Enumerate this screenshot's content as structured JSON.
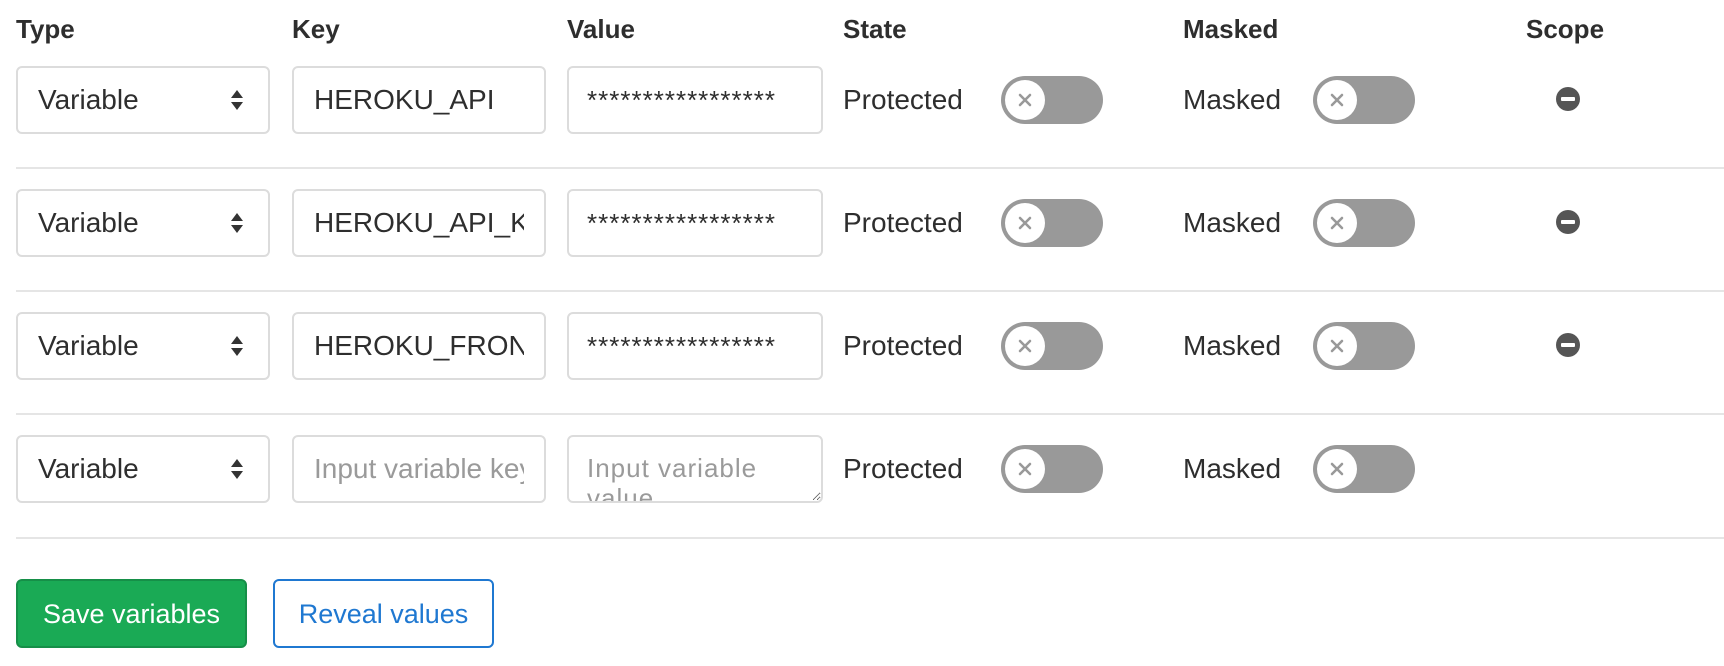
{
  "headers": {
    "type": "Type",
    "key": "Key",
    "value": "Value",
    "state": "State",
    "masked": "Masked",
    "scope": "Scope"
  },
  "rows": [
    {
      "type": "Variable",
      "key": "HEROKU_API",
      "value": "*****************",
      "state_label": "Protected",
      "masked_label": "Masked",
      "protected": false,
      "masked": false,
      "removable": true
    },
    {
      "type": "Variable",
      "key": "HEROKU_API_KEY",
      "value": "*****************",
      "state_label": "Protected",
      "masked_label": "Masked",
      "protected": false,
      "masked": false,
      "removable": true
    },
    {
      "type": "Variable",
      "key": "HEROKU_FRONTEND",
      "value": "*****************",
      "state_label": "Protected",
      "masked_label": "Masked",
      "protected": false,
      "masked": false,
      "removable": true
    },
    {
      "type": "Variable",
      "key": "",
      "value": "",
      "key_placeholder": "Input variable key",
      "value_placeholder": "Input variable value",
      "state_label": "Protected",
      "masked_label": "Masked",
      "protected": false,
      "masked": false,
      "removable": false
    }
  ],
  "actions": {
    "save_label": "Save variables",
    "reveal_label": "Reveal values"
  },
  "colors": {
    "save_button": "#1aaa55",
    "reveal_button": "#1f78d1",
    "toggle_off": "#999999",
    "remove_icon": "#555555"
  },
  "icons": {
    "select_caret": "sort-caret-icon",
    "toggle_off": "close-icon",
    "remove": "remove-circle-icon"
  }
}
